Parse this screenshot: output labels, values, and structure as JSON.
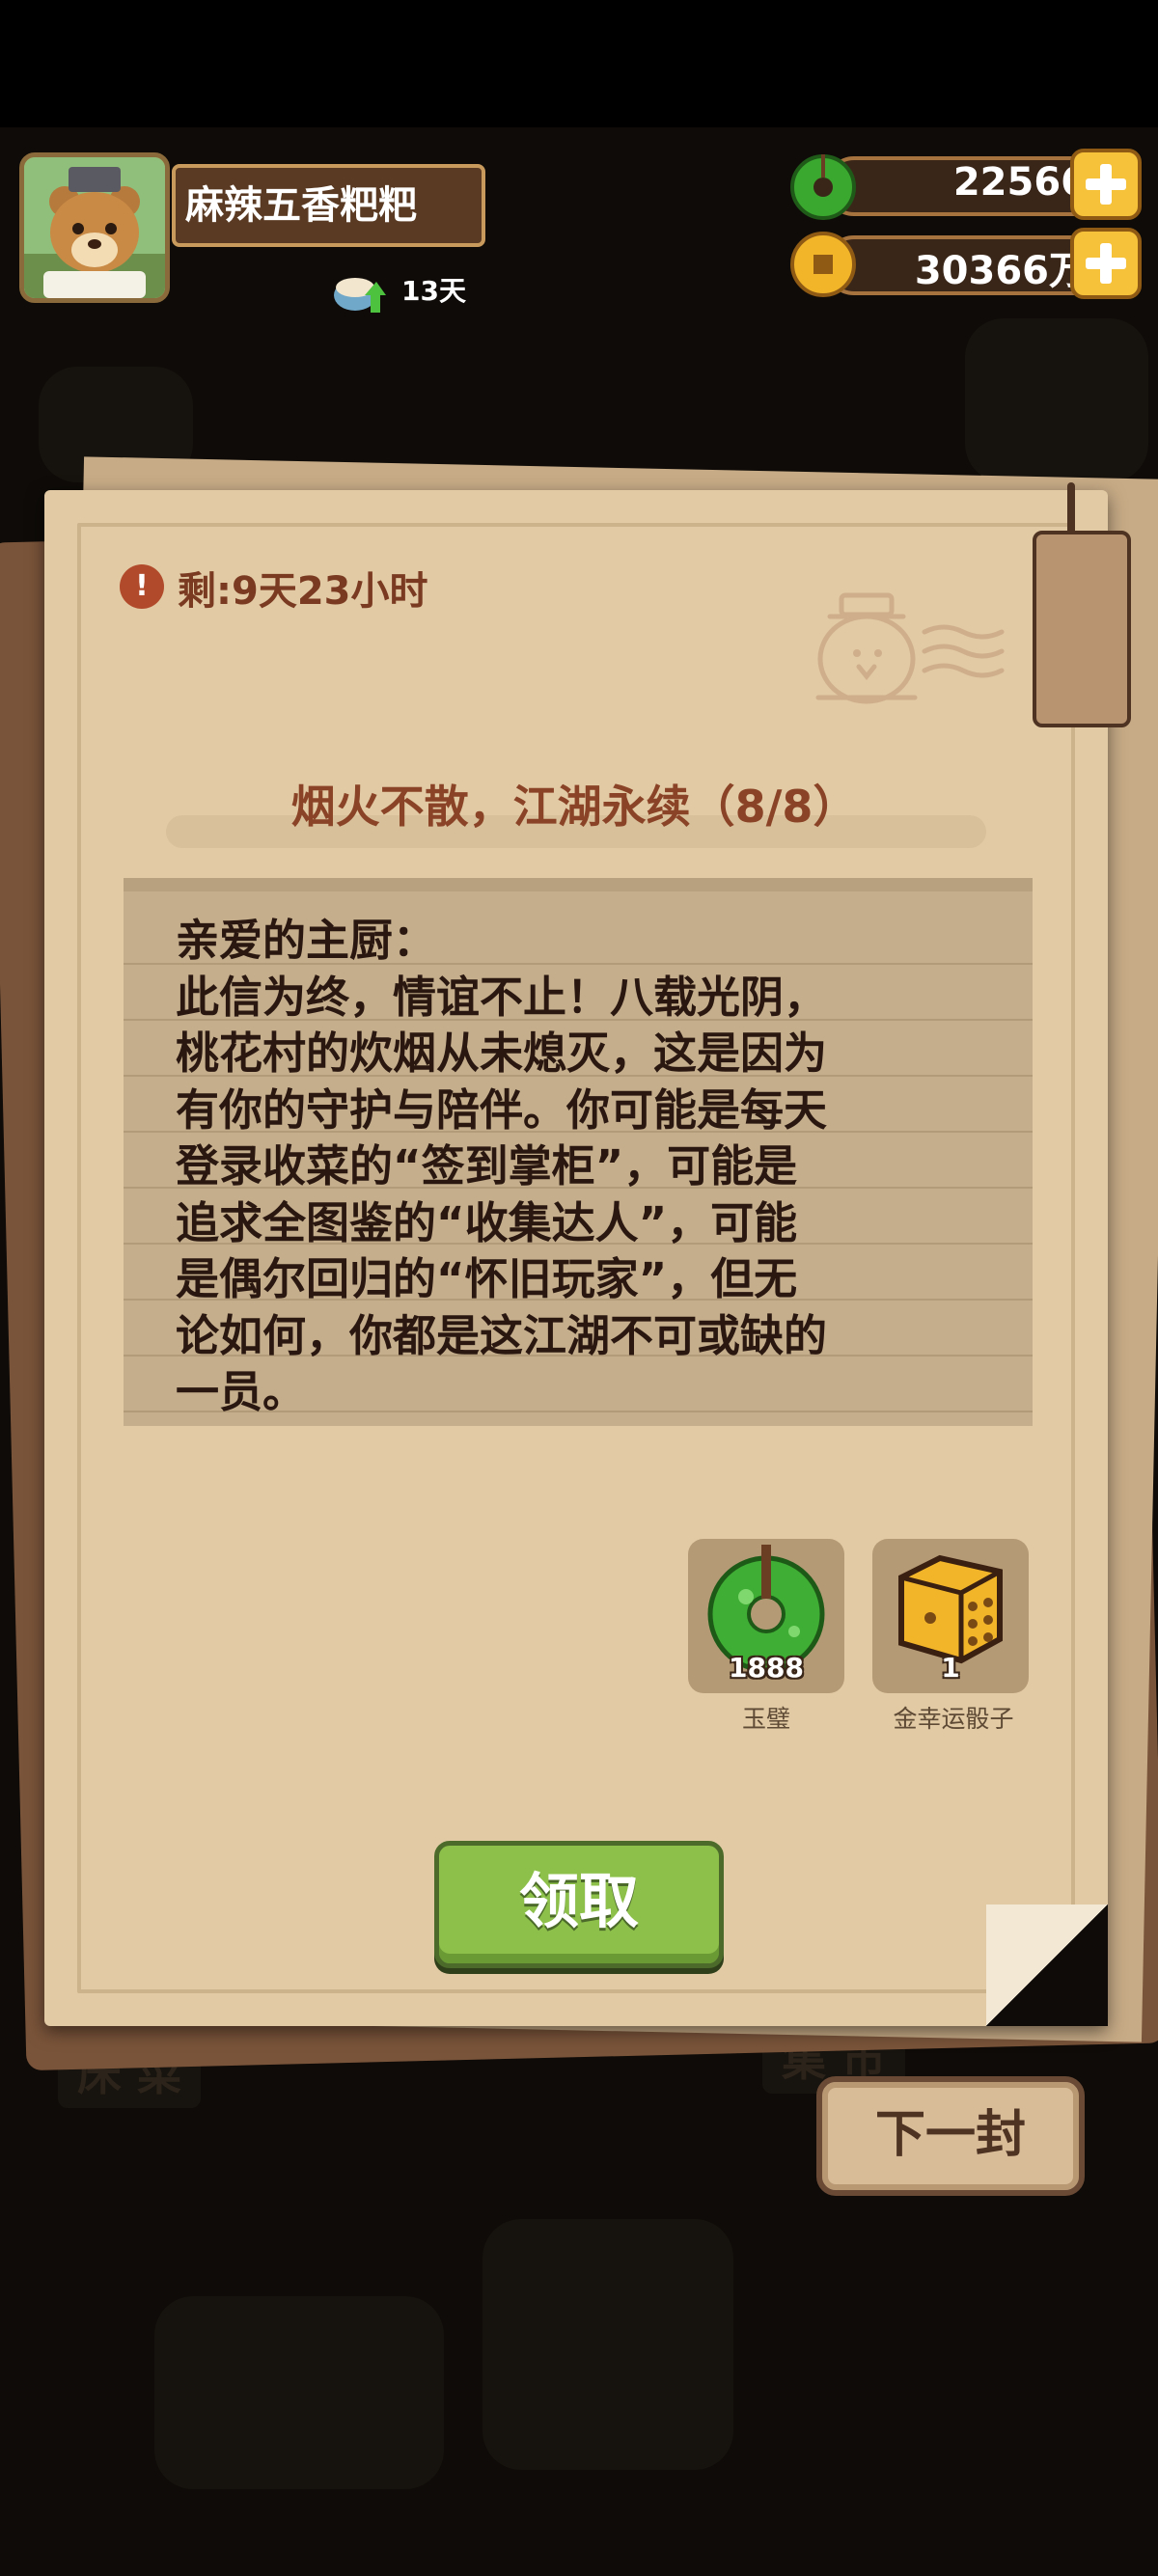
{
  "player": {
    "name": "麻辣五香粑粑",
    "login_days": "13天"
  },
  "currencies": [
    {
      "name": "jade",
      "amount": "22566",
      "color": "#47b83a"
    },
    {
      "name": "copper-coin",
      "amount": "30366万",
      "color": "#f2b52a"
    }
  ],
  "letter": {
    "time_left": "剩:9天23小时",
    "title": "烟火不散，江湖永续（8/8）",
    "body": "亲爱的主厨：\n此信为终，情谊不止！八载光阴，\n桃花村的炊烟从未熄灭，这是因为\n有你的守护与陪伴。你可能是每天\n登录收菜的“签到掌柜”，可能是\n追求全图鉴的“收集达人”，可能\n是偶尔回归的“怀旧玩家”，但无\n论如何，你都是这江湖不可或缺的\n一员。",
    "rewards": [
      {
        "label": "玉璧",
        "count": "1888",
        "icon": "jade-disc-icon"
      },
      {
        "label": "金幸运骰子",
        "count": "1",
        "icon": "gold-dice-icon"
      }
    ],
    "claim_label": "领取"
  },
  "next_label": "下一封",
  "colors": {
    "accent_green": "#8cc04a",
    "title_brown": "#8a4326",
    "paper": "#e1caa4"
  }
}
